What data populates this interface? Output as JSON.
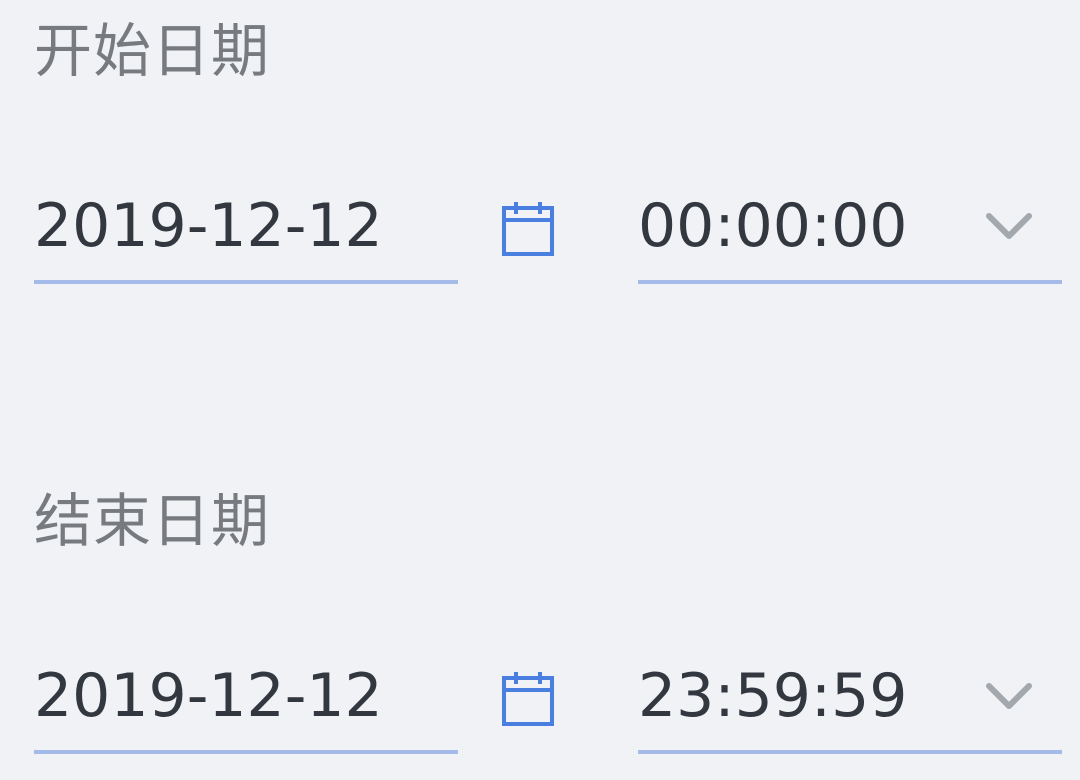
{
  "start": {
    "label": "开始日期",
    "date": "2019-12-12",
    "time": "00:00:00"
  },
  "end": {
    "label": "结束日期",
    "date": "2019-12-12",
    "time": "23:59:59"
  },
  "icons": {
    "calendar": "calendar-icon",
    "dropdown": "chevron-down-icon"
  },
  "colors": {
    "background": "#f0f2f5",
    "label": "#777b80",
    "value": "#333840",
    "underline": "#a4bbe9",
    "calendar_icon": "#4a7fe0",
    "chevron": "#a3a8ae"
  }
}
